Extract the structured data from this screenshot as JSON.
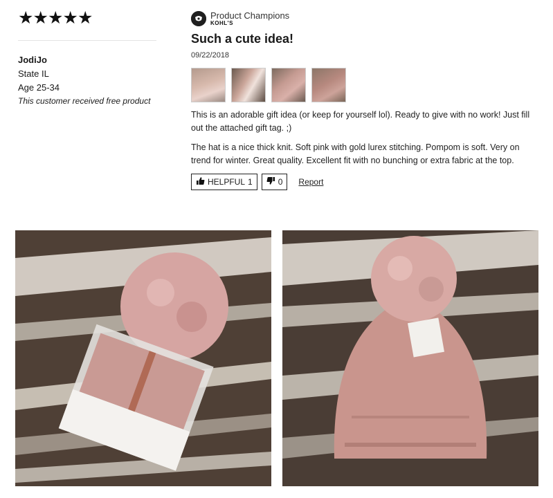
{
  "review": {
    "rating": 5,
    "stars": [
      "★",
      "★",
      "★",
      "★",
      "★"
    ],
    "username": "JodiJo",
    "state": "State IL",
    "age": "Age 25-34",
    "free_product": "This customer received free product",
    "champion_title": "Product Champions",
    "champion_brand": "KOHL'S",
    "title": "Such a cute idea!",
    "date": "09/22/2018",
    "paragraph1": "This is an adorable gift idea (or keep for yourself lol). Ready to give with no work! Just fill out the attached gift tag. ;)",
    "paragraph2": "The hat is a nice thick knit. Soft pink with gold lurex stitching. Pompom is soft. Very on trend for winter. Great quality. Excellent fit with no bunching or extra fabric at the top.",
    "helpful_label": "HELPFUL",
    "helpful_count": "1",
    "unhelpful_count": "0",
    "report_label": "Report",
    "thumbnails": [
      "thumbnail-photo-1",
      "thumbnail-photo-2",
      "thumbnail-photo-3",
      "thumbnail-photo-4"
    ]
  },
  "icons": {
    "star": "star-icon",
    "badge": "product-champion-badge-icon",
    "thumbs_up": "thumbs-up-icon",
    "thumbs_down": "thumbs-down-icon"
  },
  "colors": {
    "text": "#1a1a1a",
    "divider": "#e3e3e3",
    "pink": "#d8a9a4",
    "wood": "#5c4b3f"
  }
}
